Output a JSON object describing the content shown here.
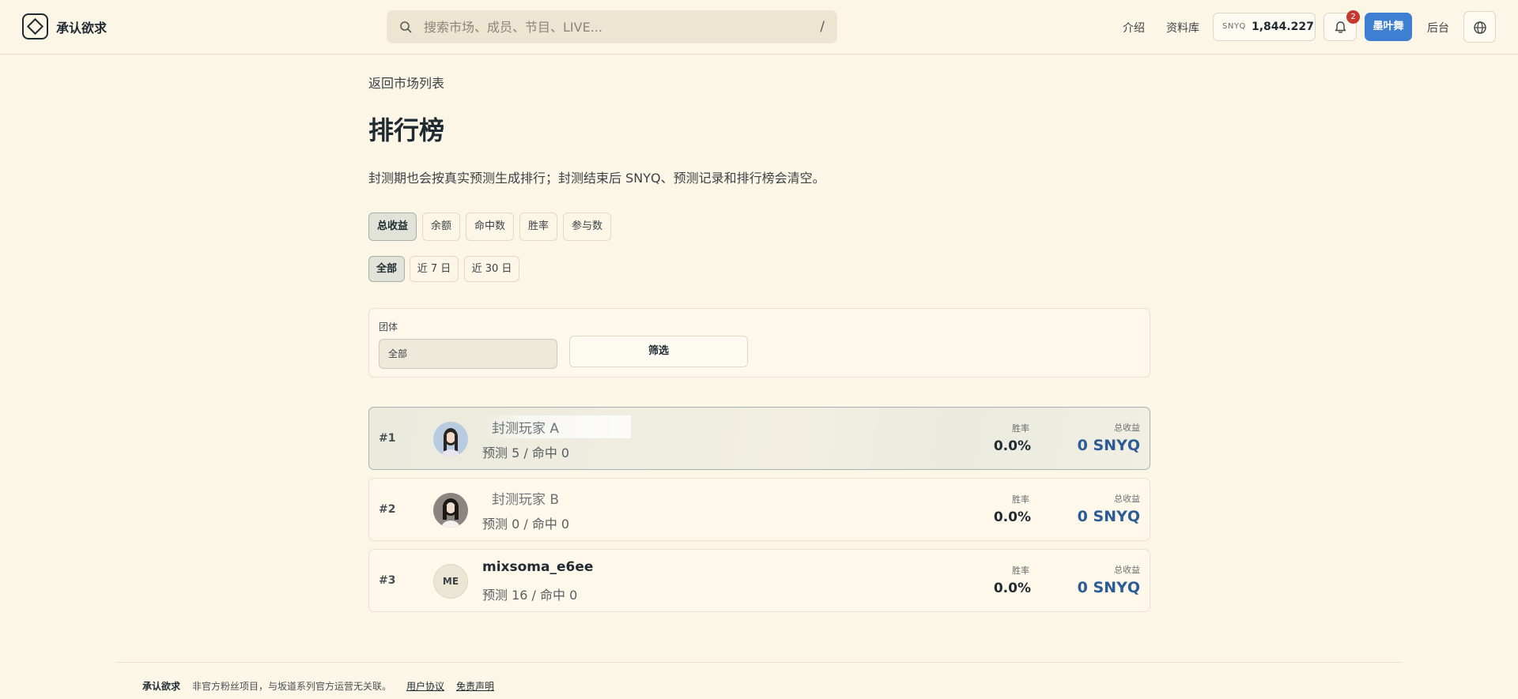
{
  "header": {
    "brand": "承认欲求",
    "search_placeholder": "搜索市场、成员、节目、LIVE...",
    "search_shortcut": "/",
    "nav": {
      "intro": "介绍",
      "library": "资料库",
      "admin": "后台"
    },
    "balance": {
      "unit": "SNYQ",
      "amount": "1,844.227"
    },
    "notification_count": "2",
    "user_name": "墨叶舞"
  },
  "main": {
    "back_link": "返回市场列表",
    "title": "排行榜",
    "description": "封测期也会按真实预测生成排行；封测结束后 SNYQ、预测记录和排行榜会清空。",
    "sort_tabs": [
      "总收益",
      "余额",
      "命中数",
      "胜率",
      "参与数"
    ],
    "sort_active": "总收益",
    "period_tabs": [
      "全部",
      "近 7 日",
      "近 30 日"
    ],
    "period_active": "全部",
    "filter": {
      "label": "团体",
      "selected": "全部",
      "button": "筛选"
    },
    "stat_labels": {
      "win_rate": "胜率",
      "profit": "总收益"
    },
    "leaderboard": [
      {
        "rank": "#1",
        "name": "封测玩家 A",
        "stats": "预测 5 / 命中 0",
        "win_rate": "0.0%",
        "profit": "0 SNYQ"
      },
      {
        "rank": "#2",
        "name": "封测玩家 B",
        "stats": "预测 0 / 命中 0",
        "win_rate": "0.0%",
        "profit": "0 SNYQ"
      },
      {
        "rank": "#3",
        "name": "mixsoma_e6ee",
        "initials": "ME",
        "stats": "预测 16 / 命中 0",
        "win_rate": "0.0%",
        "profit": "0 SNYQ"
      }
    ]
  },
  "footer": {
    "brand": "承认欲求",
    "note": "非官方粉丝项目，与坂道系列官方运营无关联。",
    "terms": "用户协议",
    "disclaimer": "免责声明"
  },
  "colors": {
    "background": "#fcf6e6",
    "accent_blue": "#3f7fd1",
    "profit_blue": "#2c5c96",
    "badge_red": "#c5392e"
  }
}
